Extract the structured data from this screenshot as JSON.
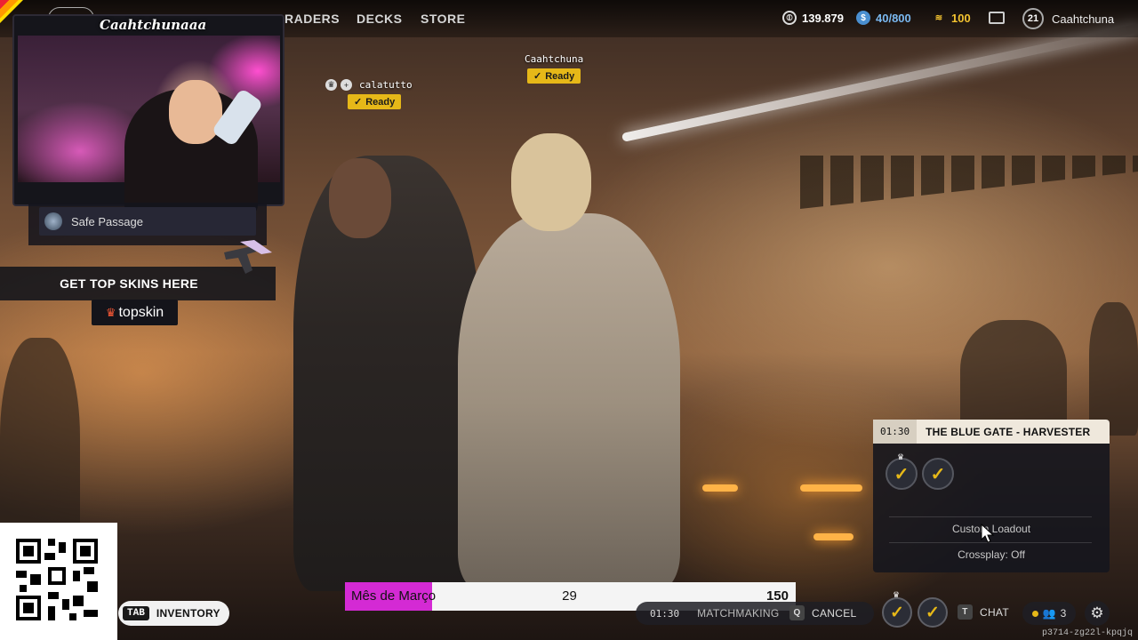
{
  "nav": {
    "items": [
      "RADERS",
      "DECKS",
      "STORE"
    ]
  },
  "currency": {
    "credits": "139.879",
    "raider_tokens": "40/800",
    "cred": "100"
  },
  "player": {
    "level": "21",
    "name": "Caahtchuna"
  },
  "webcam": {
    "title": "Caahtchunaaa",
    "pinned_item": "Safe Passage"
  },
  "promo": {
    "headline": "GET TOP SKINS HERE",
    "brand": "topskin"
  },
  "party": [
    {
      "name": "Caahtchuna",
      "status": "Ready"
    },
    {
      "name": "calatutto",
      "status": "Ready"
    }
  ],
  "matchmaking_panel": {
    "timer": "01:30",
    "map": "THE BLUE GATE - HARVESTER",
    "loadout": "Custom Loadout",
    "crossplay": "Crossplay: Off"
  },
  "inventory": {
    "key": "TAB",
    "label": "INVENTORY"
  },
  "goal": {
    "label": "Mês de Março",
    "current": "29",
    "target": "150",
    "progress": 0.193
  },
  "matchmaking_bar": {
    "timer": "01:30",
    "label": "MATCHMAKING",
    "cancel_key": "Q",
    "cancel_label": "CANCEL",
    "chat_key": "T",
    "chat_label": "CHAT",
    "party_size": "3"
  },
  "session_code": "p3714-zg22l-kpqjq",
  "colors": {
    "ready": "#e6b818",
    "goal_fill": "#d42ad4"
  }
}
